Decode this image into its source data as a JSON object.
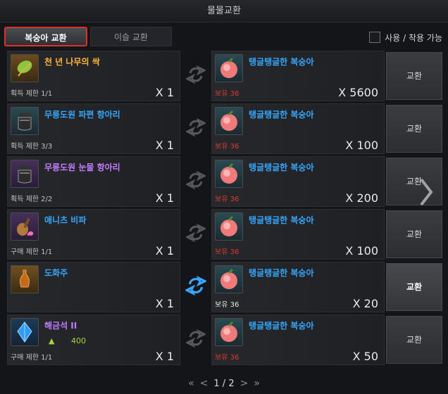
{
  "window": {
    "title": "물물교환"
  },
  "tabs": [
    {
      "label": "복숭아 교환",
      "active": true
    },
    {
      "label": "이슬 교환",
      "active": false
    }
  ],
  "filter": {
    "usable_label": "사용 / 착용 가능"
  },
  "rows": [
    {
      "give_name": "천 년 나무의 싹",
      "give_name_color": "orange",
      "give_icon": "sprout-icon",
      "give_limit": "획득 제한 1/1",
      "give_qty": "X 1",
      "get_name": "탱글탱글한 복숭아",
      "get_own": "보유 36",
      "get_qty": "X 5600",
      "button": "교환",
      "active": false
    },
    {
      "give_name": "무릉도원 파편 항아리",
      "give_name_color": "blue",
      "give_icon": "jar-icon",
      "give_limit": "획득 제한 3/3",
      "give_qty": "X 1",
      "get_name": "탱글탱글한 복숭아",
      "get_own": "보유 36",
      "get_qty": "X 100",
      "button": "교환",
      "active": false
    },
    {
      "give_name": "무릉도원 눈물 항아리",
      "give_name_color": "violet",
      "give_icon": "jar-icon",
      "give_limit": "획득 제한 2/2",
      "give_qty": "X 1",
      "get_name": "탱글탱글한 복숭아",
      "get_own": "보유 36",
      "get_qty": "X 200",
      "button": "교환",
      "active": false
    },
    {
      "give_name": "애니츠 비파",
      "give_name_color": "blue",
      "give_icon": "lute-icon",
      "give_limit": "구매 제한 1/1",
      "give_qty": "X 1",
      "get_name": "탱글탱글한 복숭아",
      "get_own": "보유 36",
      "get_qty": "X 100",
      "button": "교환",
      "active": false
    },
    {
      "give_name": "도화주",
      "give_name_color": "blue",
      "give_icon": "wine-bottle-icon",
      "give_limit": "",
      "give_qty": "X 1",
      "get_name": "탱글탱글한 복숭아",
      "get_own": "보유 36",
      "get_qty": "X 20",
      "button": "교환",
      "active": true
    },
    {
      "give_name": "해금석 II",
      "give_name_color": "violet",
      "give_icon": "crystal-icon",
      "give_sub": "400",
      "give_limit": "구매 제한 1/1",
      "give_qty": "X 1",
      "get_name": "탱글탱글한 복숭아",
      "get_own": "보유 36",
      "get_qty": "X 50",
      "button": "교환",
      "active": false
    }
  ],
  "pager": {
    "first": "«",
    "prev": "<",
    "text": "1 / 2",
    "next": ">",
    "last": "»"
  }
}
